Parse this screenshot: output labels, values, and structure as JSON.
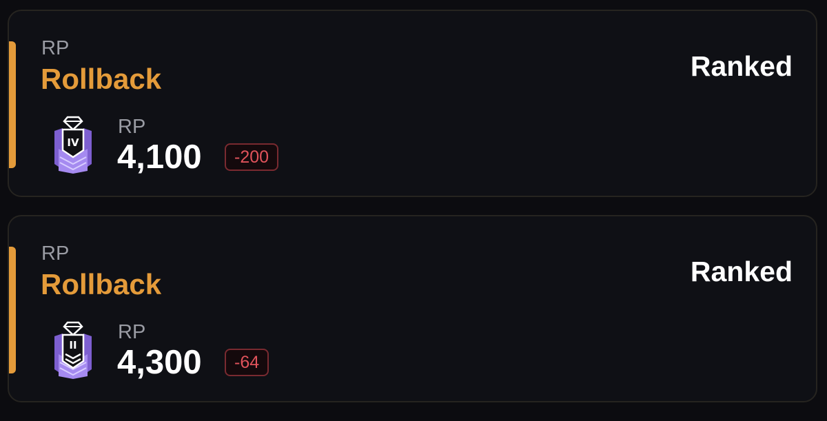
{
  "cards": [
    {
      "type_label": "RP",
      "title": "Rollback",
      "mode": "Ranked",
      "rank_icon": "rank-badge-IV-icon",
      "rank_numeral": "IV",
      "rp_label": "RP",
      "rp_value": "4,100",
      "delta": "-200"
    },
    {
      "type_label": "RP",
      "title": "Rollback",
      "mode": "Ranked",
      "rank_icon": "rank-badge-II-icon",
      "rank_numeral": "II",
      "rp_label": "RP",
      "rp_value": "4,300",
      "delta": "-64"
    }
  ],
  "colors": {
    "accent": "#e49b3a",
    "negative": "#e0535b",
    "rank_purple": "#8f6ee0"
  }
}
